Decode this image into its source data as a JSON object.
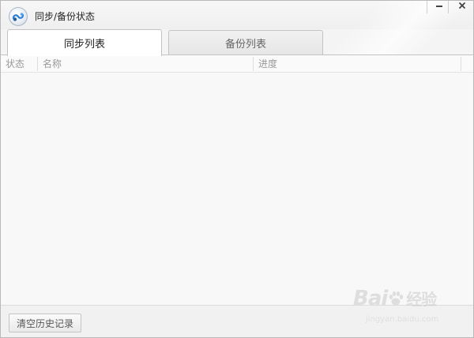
{
  "window": {
    "title": "同步/备份状态",
    "minimize_label": "−",
    "close_label": "×"
  },
  "tabs": [
    {
      "label": "同步列表",
      "active": true
    },
    {
      "label": "备份列表",
      "active": false
    }
  ],
  "list": {
    "columns": [
      "状态",
      "名称",
      "进度"
    ],
    "rows": []
  },
  "footer": {
    "clear_history_label": "清空历史记录"
  },
  "watermark": {
    "logo_text": "Bai",
    "logo_suffix": "经验",
    "url": "jingyan.baidu.com"
  },
  "colors": {
    "accent": "#2e7fd6",
    "border": "#c3c3c3"
  }
}
